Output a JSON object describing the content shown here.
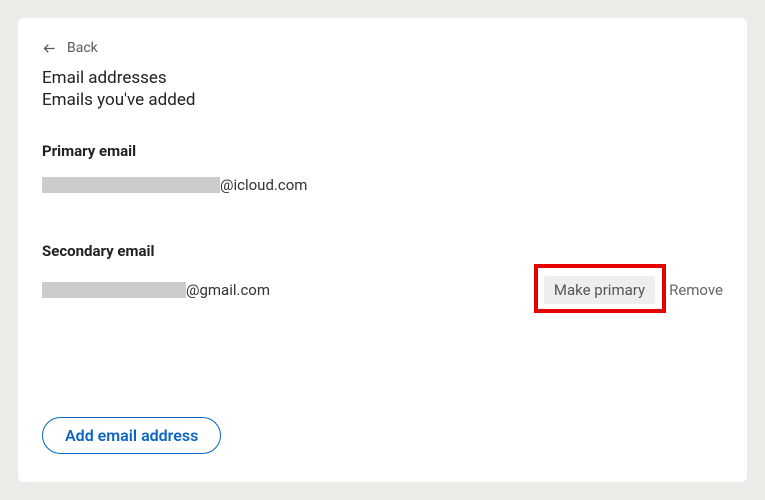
{
  "back": {
    "label": "Back"
  },
  "header": {
    "title": "Email addresses",
    "subtitle": "Emails you've added"
  },
  "primary": {
    "label": "Primary email",
    "domain": "@icloud.com"
  },
  "secondary": {
    "label": "Secondary email",
    "domain": "@gmail.com",
    "makePrimaryLabel": "Make primary",
    "removeLabel": "Remove"
  },
  "addEmail": {
    "label": "Add email address"
  },
  "highlight": {
    "target": "make-primary-button"
  }
}
